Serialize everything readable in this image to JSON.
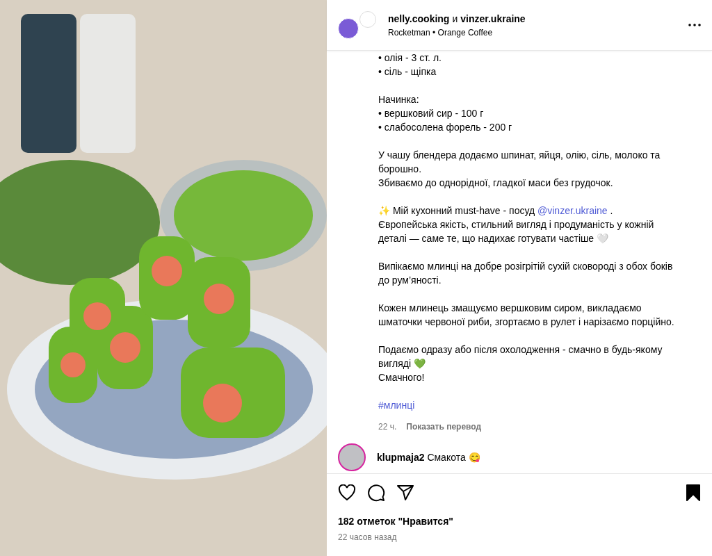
{
  "post_header": {
    "author": "nelly.cooking",
    "conjunction": "и",
    "coauthor": "vinzer.ukraine",
    "audio": "Rocketman • Orange Coffee"
  },
  "caption": [
    {
      "kind": "line",
      "text": "• олія - 3 ст. л."
    },
    {
      "kind": "line",
      "text": "• сіль - щіпка"
    },
    {
      "kind": "gap"
    },
    {
      "kind": "line",
      "text": "Начинка:"
    },
    {
      "kind": "line",
      "text": "• вершковий сир - 100 г"
    },
    {
      "kind": "line",
      "text": "• слабосолена форель - 200 г"
    },
    {
      "kind": "gap"
    },
    {
      "kind": "line",
      "text": "У чашу блендера додаємо шпинат, яйця, олію, сіль, молоко та борошно."
    },
    {
      "kind": "line",
      "text": "Збиваємо до однорідної, гладкої маси без грудочок."
    },
    {
      "kind": "gap"
    },
    {
      "kind": "mention",
      "before": "✨ Мій кухонний must-have - посуд",
      "link": "@vinzer.ukraine",
      "after": "."
    },
    {
      "kind": "line",
      "text": "Європейська якість, стильний вигляд і продуманість у кожній деталі — саме те, що надихає готувати частіше 🤍"
    },
    {
      "kind": "gap"
    },
    {
      "kind": "line",
      "text": "Випікаємо млинці на добре розігрітій сухій сковороді з обох боків до рум’яності."
    },
    {
      "kind": "gap"
    },
    {
      "kind": "line",
      "text": "Кожен млинець змащуємо вершковим сиром, викладаємо шматочки червоної риби, згортаємо в рулет і нарізаємо порційно."
    },
    {
      "kind": "gap"
    },
    {
      "kind": "line",
      "text": "Подаємо одразу або після охолодження - смачно в будь-якому вигляді 💚"
    },
    {
      "kind": "line",
      "text": "Смачного!"
    },
    {
      "kind": "gap"
    },
    {
      "kind": "hashtag",
      "text": "#млинці"
    }
  ],
  "caption_meta": {
    "time": "22 ч.",
    "translate": "Показать перевод"
  },
  "comment": {
    "user": "klupmaja2",
    "text": "Смакота 😋"
  },
  "actions": {
    "liked": false,
    "saved": true
  },
  "likes": "182 отметок \"Нравится\"",
  "posted": "22 часов назад"
}
